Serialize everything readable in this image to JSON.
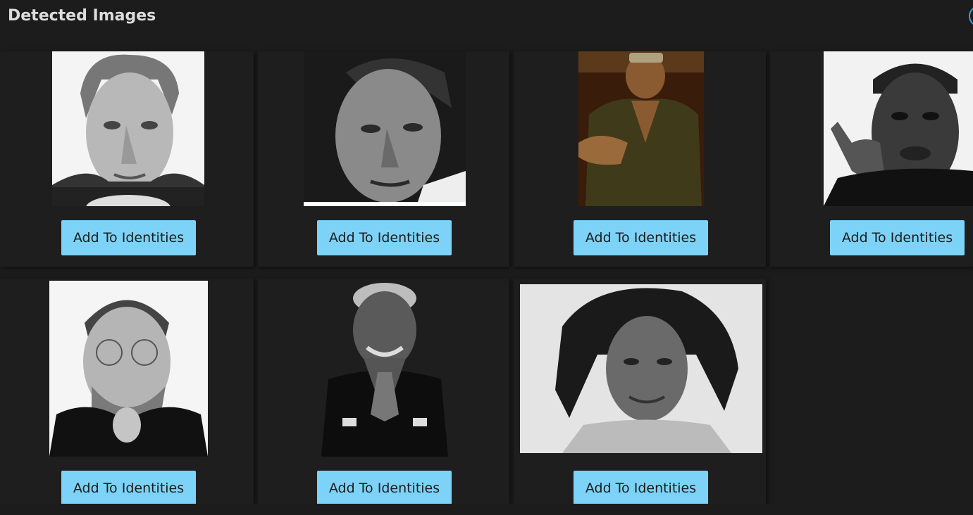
{
  "header": {
    "title": "Detected Images"
  },
  "button_label": "Add To Identities",
  "accent_color": "#7dd3f7",
  "images": [
    {
      "index": 1,
      "icon": "portrait-photo",
      "bg": "light"
    },
    {
      "index": 2,
      "icon": "portrait-photo",
      "bg": "dark"
    },
    {
      "index": 3,
      "icon": "portrait-photo",
      "bg": "color"
    },
    {
      "index": 4,
      "icon": "portrait-photo",
      "bg": "light"
    },
    {
      "index": 5,
      "icon": "portrait-photo",
      "bg": "light"
    },
    {
      "index": 6,
      "icon": "portrait-photo",
      "bg": "dark"
    },
    {
      "index": 7,
      "icon": "portrait-photo",
      "bg": "light"
    }
  ]
}
